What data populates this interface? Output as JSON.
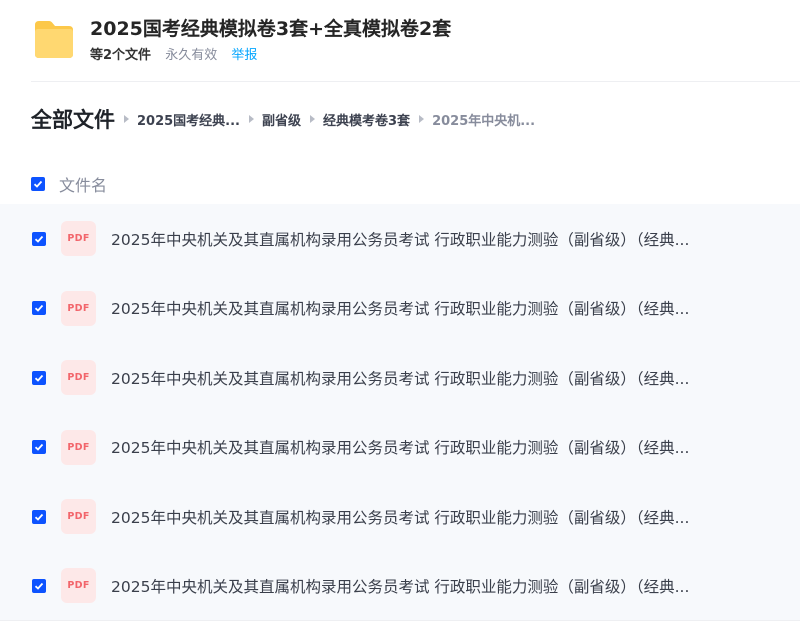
{
  "share": {
    "title": "2025国考经典模拟卷3套+全真模拟卷2套",
    "file_count": "等2个文件",
    "expiry": "永久有效",
    "report_label": "举报",
    "folder_icon": "folder-icon"
  },
  "breadcrumb": {
    "root": "全部文件",
    "items": [
      "2025国考经典...",
      "副省级",
      "经典模考卷3套",
      "2025年中央机..."
    ]
  },
  "list": {
    "column_header": "文件名",
    "header_checked": true,
    "files": [
      {
        "name": "2025年中央机关及其直属机构录用公务员考试 行政职业能力测验（副省级）（经典...",
        "type": "PDF",
        "checked": true
      },
      {
        "name": "2025年中央机关及其直属机构录用公务员考试 行政职业能力测验（副省级）（经典...",
        "type": "PDF",
        "checked": true
      },
      {
        "name": "2025年中央机关及其直属机构录用公务员考试 行政职业能力测验（副省级）（经典...",
        "type": "PDF",
        "checked": true
      },
      {
        "name": "2025年中央机关及其直属机构录用公务员考试 行政职业能力测验（副省级）（经典...",
        "type": "PDF",
        "checked": true
      },
      {
        "name": "2025年中央机关及其直属机构录用公务员考试 行政职业能力测验（副省级）（经典...",
        "type": "PDF",
        "checked": true
      },
      {
        "name": "2025年中央机关及其直属机构录用公务员考试 行政职业能力测验（副省级）（经典...",
        "type": "PDF",
        "checked": true
      }
    ]
  },
  "colors": {
    "accent": "#0d53ff",
    "link": "#06a7ff",
    "pdf_red": "#f2656b",
    "folder_yellow": "#fcc84a"
  }
}
